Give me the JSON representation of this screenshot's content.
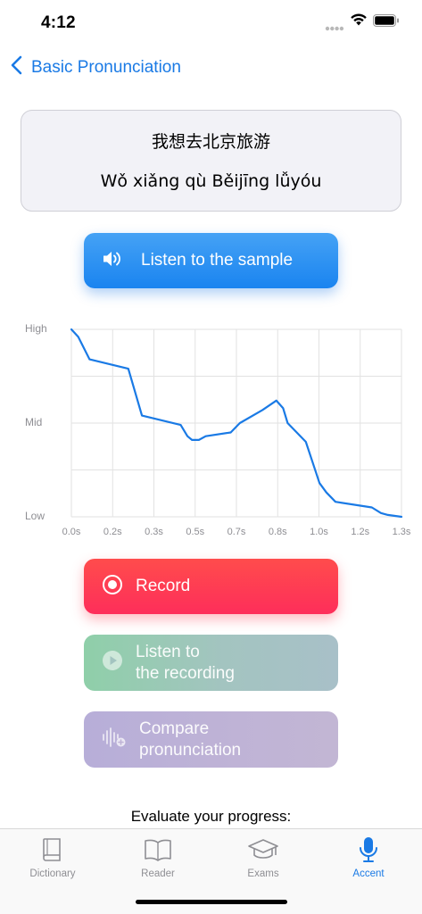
{
  "status_bar": {
    "time": "4:12",
    "icons": [
      "signal-dots-icon",
      "wifi-icon",
      "battery-icon"
    ]
  },
  "nav": {
    "back_label": "Basic Pronunciation",
    "back_icon": "chevron-left-icon"
  },
  "phrase": {
    "hanzi": "我想去北京旅游",
    "pinyin": "Wǒ xiǎng qù Běijīng lǚyóu"
  },
  "buttons": {
    "listen_sample": {
      "label": "Listen to the sample",
      "icon": "speaker-icon"
    },
    "record": {
      "label": "Record",
      "icon": "record-icon"
    },
    "listen_recording": {
      "label_line1": "Listen to",
      "label_line2": "the recording",
      "icon": "play-icon"
    },
    "compare": {
      "label_line1": "Compare",
      "label_line2": "pronunciation",
      "icon": "waveform-compare-icon"
    }
  },
  "chart_data": {
    "type": "line",
    "y_tick_labels": [
      "High",
      "Mid",
      "Low"
    ],
    "x_tick_labels": [
      "0.0s",
      "0.2s",
      "0.3s",
      "0.5s",
      "0.7s",
      "0.8s",
      "1.0s",
      "1.2s",
      "1.3s"
    ],
    "xlim": [
      0,
      1.45
    ],
    "ylim": [
      0,
      1
    ],
    "grid": true,
    "line_color": "#1a7ae5",
    "x": [
      0.0,
      0.03,
      0.08,
      0.25,
      0.31,
      0.48,
      0.51,
      0.53,
      0.56,
      0.59,
      0.7,
      0.74,
      0.84,
      0.9,
      0.93,
      0.95,
      1.03,
      1.09,
      1.12,
      1.16,
      1.32,
      1.36,
      1.39,
      1.45
    ],
    "y": [
      1.0,
      0.96,
      0.84,
      0.79,
      0.54,
      0.49,
      0.43,
      0.41,
      0.41,
      0.43,
      0.45,
      0.5,
      0.57,
      0.62,
      0.58,
      0.5,
      0.4,
      0.18,
      0.13,
      0.08,
      0.05,
      0.02,
      0.01,
      0.0
    ]
  },
  "evaluate_text": "Evaluate your progress:",
  "tabbar": {
    "active": "Accent",
    "active_color": "#1a7ae5",
    "items": [
      {
        "label": "Dictionary",
        "icon": "book-icon"
      },
      {
        "label": "Reader",
        "icon": "open-book-icon"
      },
      {
        "label": "Exams",
        "icon": "graduation-cap-icon"
      },
      {
        "label": "Accent",
        "icon": "microphone-icon"
      }
    ]
  }
}
